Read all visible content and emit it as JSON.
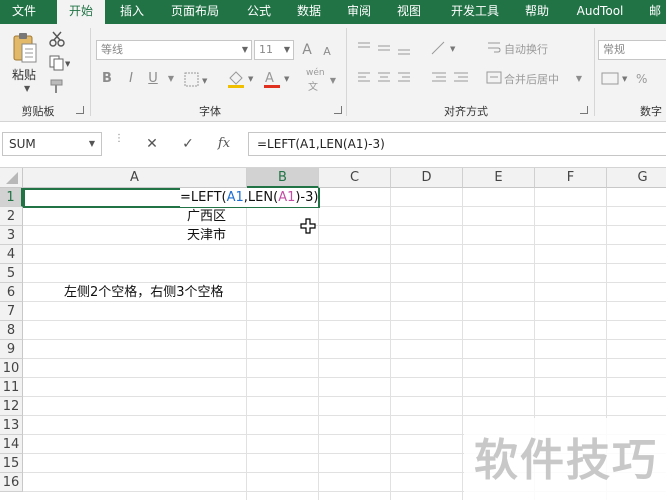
{
  "menu": {
    "tabs": [
      {
        "label": "文件",
        "active": false
      },
      {
        "label": "开始",
        "active": true
      },
      {
        "label": "插入",
        "active": false
      },
      {
        "label": "页面布局",
        "active": false
      },
      {
        "label": "公式",
        "active": false
      },
      {
        "label": "数据",
        "active": false
      },
      {
        "label": "审阅",
        "active": false
      },
      {
        "label": "视图",
        "active": false
      },
      {
        "label": "开发工具",
        "active": false
      },
      {
        "label": "帮助",
        "active": false
      },
      {
        "label": "AudTool",
        "active": false
      },
      {
        "label": "邮",
        "active": false
      }
    ]
  },
  "ribbon": {
    "clipboard": {
      "paste_label": "粘贴",
      "group_label": "剪贴板"
    },
    "font": {
      "font_name": "等线",
      "font_size": "11",
      "increase": "A",
      "decrease": "A",
      "bold": "B",
      "italic": "I",
      "underline": "U",
      "phonetic": "wén",
      "group_label": "字体"
    },
    "alignment": {
      "wrap_text": "自动换行",
      "merge_center": "合并后居中",
      "group_label": "对齐方式"
    },
    "number": {
      "format": "常规",
      "group_label": "数字"
    }
  },
  "formula_bar": {
    "name_box": "SUM",
    "cancel": "✕",
    "enter": "✓",
    "fx": "fx",
    "formula": "=LEFT(A1,LEN(A1)-3)"
  },
  "grid": {
    "columns": [
      "A",
      "B",
      "C",
      "D",
      "E",
      "F",
      "G"
    ],
    "rows": [
      "1",
      "2",
      "3",
      "4",
      "5",
      "6",
      "7",
      "8",
      "9",
      "10",
      "11",
      "12",
      "13",
      "14",
      "15",
      "16"
    ],
    "editing": {
      "prefix": "=LEFT(",
      "ref1": "A1",
      "mid": ",LEN(",
      "ref2": "A1",
      "suffix": ")-3)"
    },
    "cells": {
      "A2": "广西区",
      "A3": "天津市",
      "A6": "左侧2个空格，右侧3个空格"
    }
  },
  "watermark": "软件技巧",
  "colors": {
    "accent": "#217346",
    "ref1": "#1f6fd0",
    "ref2": "#c14fa3"
  }
}
